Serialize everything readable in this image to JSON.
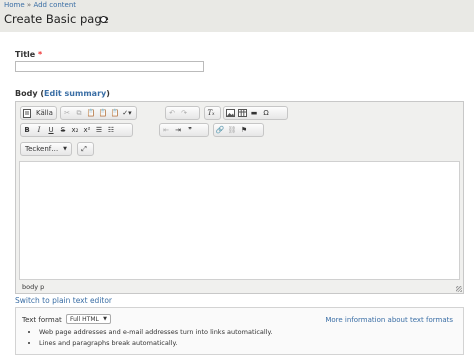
{
  "breadcrumb": {
    "home": "Home",
    "sep": "»",
    "add_content": "Add content"
  },
  "page": {
    "title": "Create Basic page"
  },
  "form": {
    "title_label": "Title",
    "required_mark": "*",
    "title_value": "",
    "body_label": "Body",
    "body_open": "(",
    "edit_summary": "Edit summary",
    "body_close": ")"
  },
  "editor": {
    "source_label": "Källa",
    "format_combo": "Teckenf…",
    "path": "body   p",
    "buttons": {
      "bold": "B",
      "italic": "I",
      "underline": "U",
      "strike": "S",
      "subscript": "x₂",
      "superscript": "x²",
      "blockquote": "❞"
    }
  },
  "switch_link": "Switch to plain text editor",
  "text_format": {
    "label": "Text format",
    "selected": "Full HTML",
    "more_info": "More information about text formats",
    "tips": [
      "Web page addresses and e-mail addresses turn into links automatically.",
      "Lines and paragraphs break automatically."
    ]
  },
  "colors": {
    "link": "#3a6ea5",
    "header_bg": "#e9e9e5",
    "required": "#ee3333"
  }
}
